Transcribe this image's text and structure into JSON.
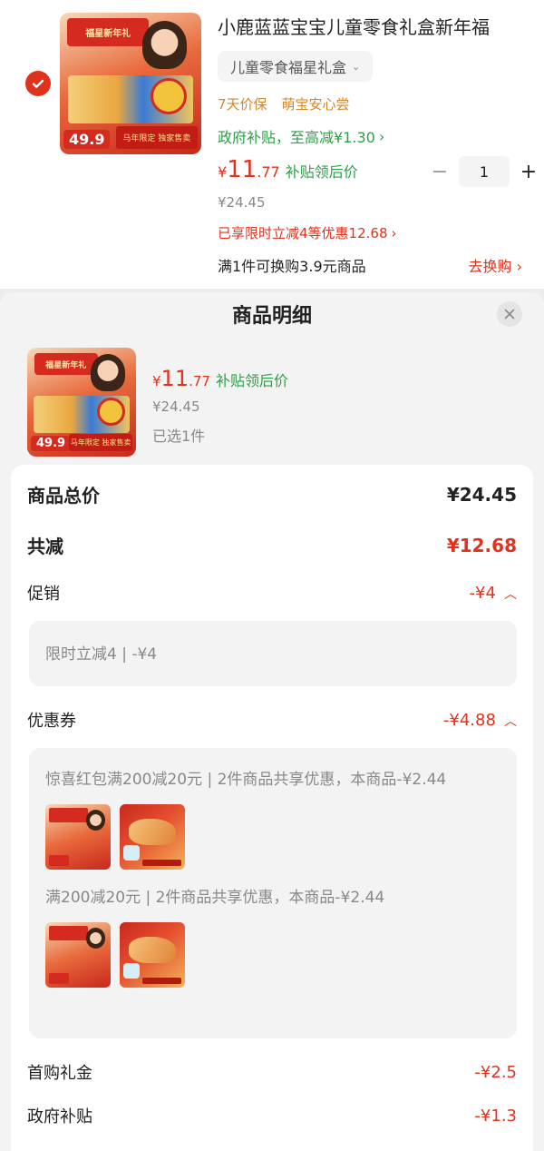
{
  "cart": {
    "product_title": "小鹿蓝蓝宝宝儿童零食礼盒新年福",
    "variant": "儿童零食福星礼盒",
    "services": [
      "7天价保",
      "萌宝安心尝"
    ],
    "gov_subsidy": "政府补贴，至高减¥1.30",
    "price": {
      "yen": "¥",
      "int": "11",
      "dec": ".77",
      "label": "补贴领后价"
    },
    "original_price": "¥24.45",
    "quantity": "1",
    "enjoyed_discount": "已享限时立减4等优惠12.68",
    "swap_text": "满1件可换购3.9元商品",
    "swap_link": "去换购",
    "thumb": {
      "top_text": "福星新年礼",
      "price_tag": "49.9",
      "ribbon": "马年限定 独家售卖"
    }
  },
  "modal": {
    "title": "商品明细",
    "item": {
      "price": {
        "yen": "¥",
        "int": "11",
        "dec": ".77",
        "label": "补贴领后价"
      },
      "original_price": "¥24.45",
      "selected": "已选1件"
    },
    "detail": {
      "total_label": "商品总价",
      "total_value": "¥24.45",
      "reduce_label": "共减",
      "reduce_value": "¥12.68",
      "promo_label": "促销",
      "promo_value": "-¥4",
      "promo_item": "限时立减4 | -¥4",
      "coupon_label": "优惠券",
      "coupon_value": "-¥4.88",
      "coupon_item1": "惊喜红包满200减20元 | 2件商品共享优惠，本商品-¥2.44",
      "coupon_item2": "满200减20元 | 2件商品共享优惠，本商品-¥2.44",
      "first_label": "首购礼金",
      "first_value": "-¥2.5",
      "gov_label": "政府补贴",
      "gov_value": "-¥1.3"
    }
  },
  "colors": {
    "accent": "#e0321d",
    "green": "#2e9e47",
    "orange": "#d4862a"
  },
  "icons": [
    "check-icon",
    "chevron-down-icon",
    "chevron-right-icon",
    "close-icon",
    "chevron-up-icon"
  ]
}
